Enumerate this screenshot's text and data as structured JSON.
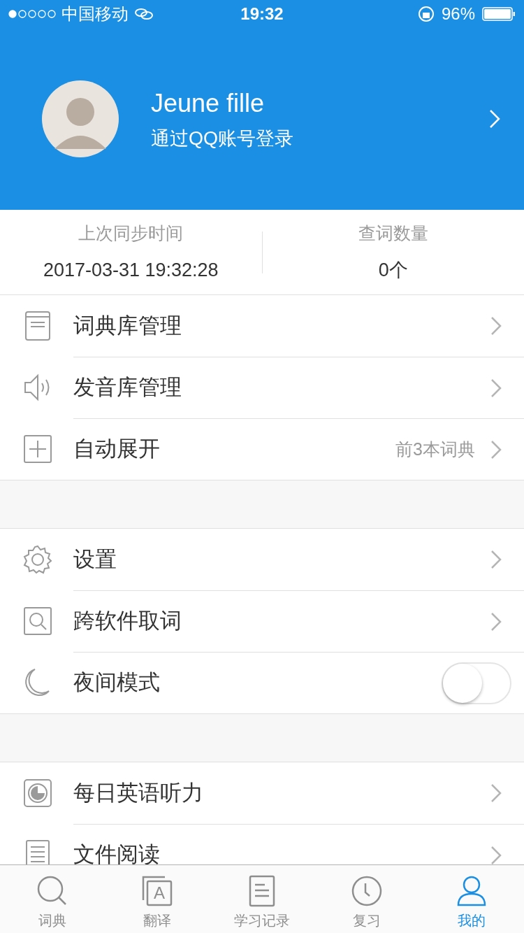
{
  "status_bar": {
    "carrier": "中国移动",
    "time": "19:32",
    "battery": "96%"
  },
  "profile": {
    "name": "Jeune fille",
    "subtitle": "通过QQ账号登录"
  },
  "stats": [
    {
      "label": "上次同步时间",
      "value": "2017-03-31 19:32:28"
    },
    {
      "label": "查词数量",
      "value": "0个"
    }
  ],
  "menu_groups": [
    [
      {
        "kind": "link",
        "label": "词典库管理"
      },
      {
        "kind": "link",
        "label": "发音库管理"
      },
      {
        "kind": "link",
        "label": "自动展开",
        "detail": "前3本词典"
      }
    ],
    [
      {
        "kind": "link",
        "label": "设置"
      },
      {
        "kind": "link",
        "label": "跨软件取词"
      },
      {
        "kind": "toggle",
        "label": "夜间模式",
        "on": false
      }
    ],
    [
      {
        "kind": "link",
        "label": "每日英语听力"
      },
      {
        "kind": "link",
        "label": "文件阅读"
      }
    ]
  ],
  "tab_bar": [
    {
      "label": "词典",
      "selected": false
    },
    {
      "label": "翻译",
      "selected": false,
      "icon_letter": "A"
    },
    {
      "label": "学习记录",
      "selected": false
    },
    {
      "label": "复习",
      "selected": false
    },
    {
      "label": "我的",
      "selected": true
    }
  ]
}
